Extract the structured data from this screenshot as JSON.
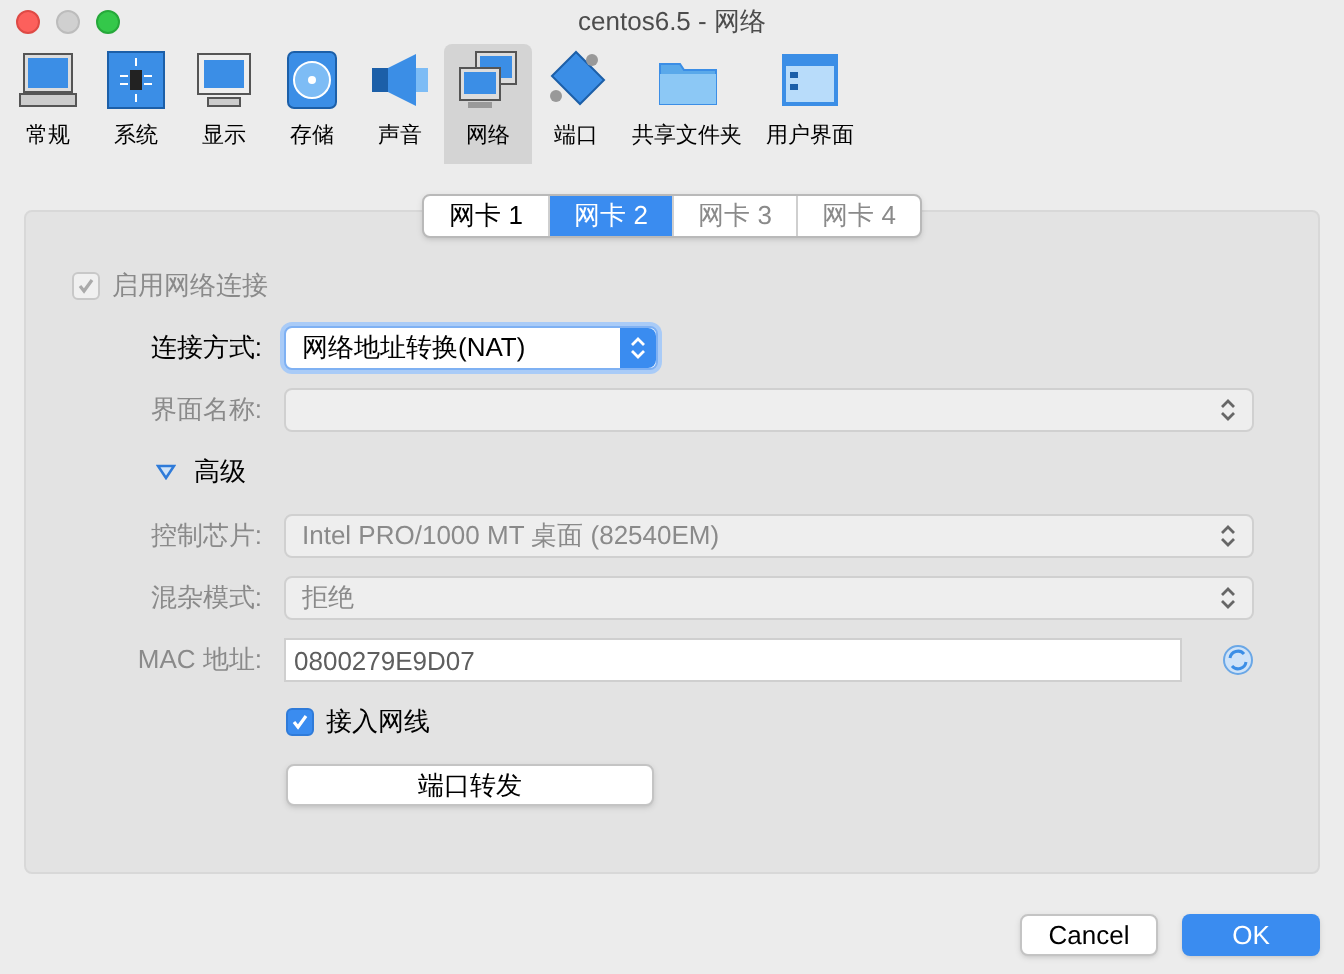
{
  "window": {
    "title": "centos6.5 - 网络"
  },
  "toolbar": [
    {
      "label": "常规",
      "kind": "computer",
      "selected": false
    },
    {
      "label": "系统",
      "kind": "chip",
      "selected": false
    },
    {
      "label": "显示",
      "kind": "monitor",
      "selected": false
    },
    {
      "label": "存储",
      "kind": "disk",
      "selected": false
    },
    {
      "label": "声音",
      "kind": "speaker",
      "selected": false
    },
    {
      "label": "网络",
      "kind": "network",
      "selected": true
    },
    {
      "label": "端口",
      "kind": "plug",
      "selected": false
    },
    {
      "label": "共享文件夹",
      "kind": "folder",
      "selected": false
    },
    {
      "label": "用户界面",
      "kind": "window",
      "selected": false
    }
  ],
  "tabs": [
    {
      "label": "网卡 1",
      "selected": false
    },
    {
      "label": "网卡 2",
      "selected": true
    },
    {
      "label": "网卡 3",
      "selected": false
    },
    {
      "label": "网卡 4",
      "selected": false
    }
  ],
  "enable_adapter": {
    "label": "启用网络连接",
    "checked": true,
    "disabled": true
  },
  "rows": [
    {
      "kind": "select",
      "label": "连接方式:",
      "value": "网络地址转换(NAT)",
      "disabled": false
    },
    {
      "kind": "select",
      "label": "界面名称:",
      "disabled": true
    }
  ],
  "advanced": {
    "label": "高级",
    "expanded": true,
    "rows": [
      {
        "kind": "select",
        "label": "控制芯片:",
        "value": "Intel PRO/1000 MT 桌面 (82540EM)",
        "disabled": true
      },
      {
        "kind": "select",
        "label": "混杂模式:",
        "value": "拒绝",
        "disabled": true
      },
      {
        "kind": "text",
        "label": "MAC 地址:",
        "value": "0800279E9D07",
        "disabled": false
      }
    ],
    "cable": {
      "label": "接入网线",
      "checked": true
    },
    "port_forwarding": {
      "label": "端口转发"
    }
  },
  "buttons": [
    {
      "label": "Cancel",
      "kind": "default"
    },
    {
      "label": "OK",
      "kind": "primary"
    }
  ]
}
